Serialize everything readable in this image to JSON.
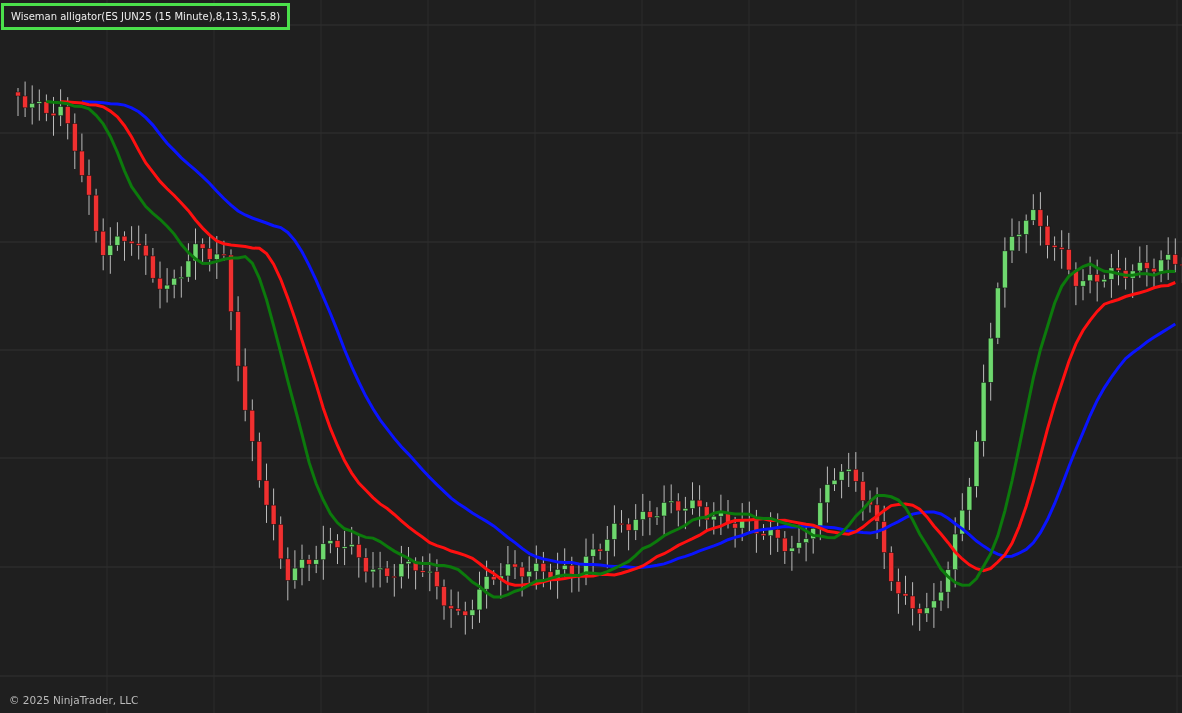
{
  "indicator_label": "Wiseman alligator(ES JUN25 (15 Minute),8,13,3,5,5,8)",
  "copyright": "© 2025 NinjaTrader, LLC"
}
